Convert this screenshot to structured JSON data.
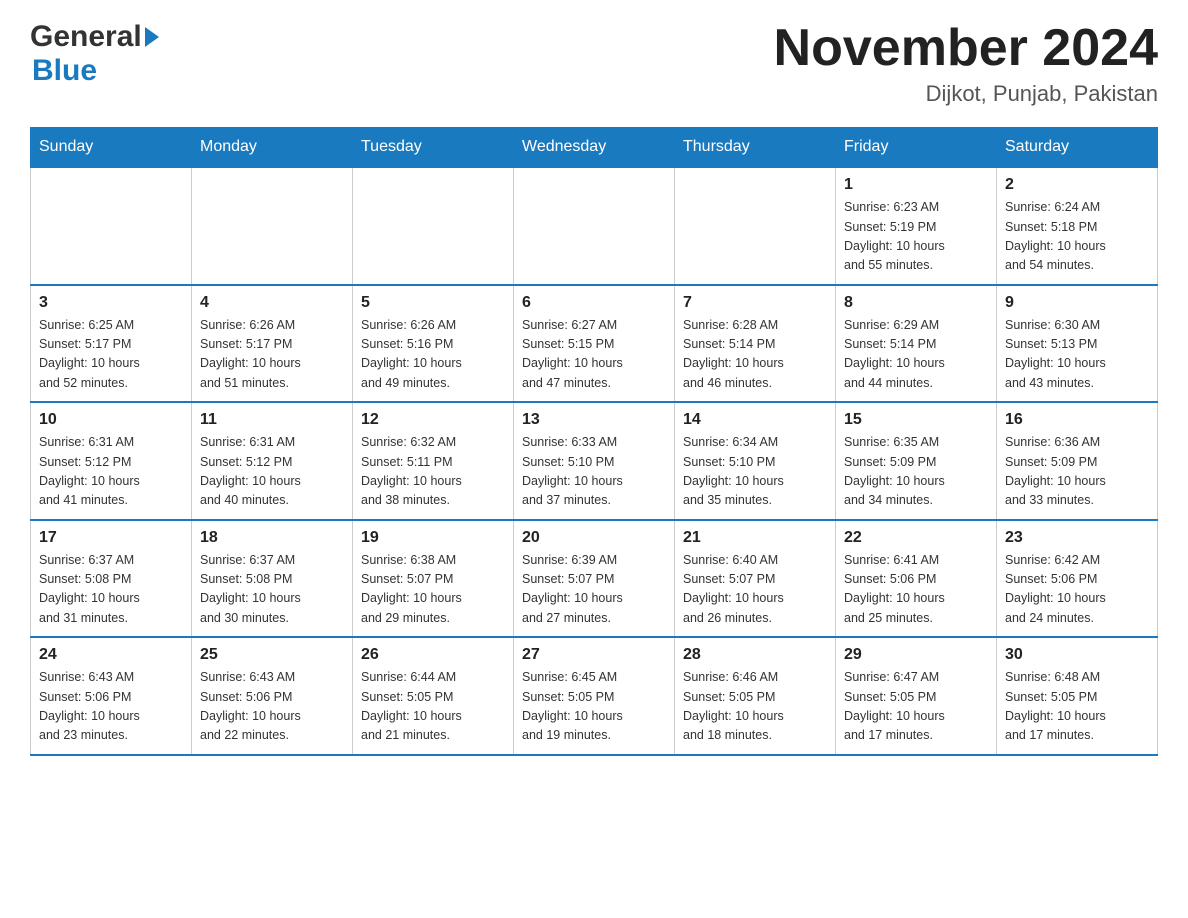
{
  "header": {
    "logo_general": "General",
    "logo_arrow_symbol": "▶",
    "logo_blue": "Blue",
    "month_title": "November 2024",
    "location": "Dijkot, Punjab, Pakistan"
  },
  "weekdays": [
    "Sunday",
    "Monday",
    "Tuesday",
    "Wednesday",
    "Thursday",
    "Friday",
    "Saturday"
  ],
  "weeks": [
    [
      {
        "day": "",
        "info": ""
      },
      {
        "day": "",
        "info": ""
      },
      {
        "day": "",
        "info": ""
      },
      {
        "day": "",
        "info": ""
      },
      {
        "day": "",
        "info": ""
      },
      {
        "day": "1",
        "info": "Sunrise: 6:23 AM\nSunset: 5:19 PM\nDaylight: 10 hours\nand 55 minutes."
      },
      {
        "day": "2",
        "info": "Sunrise: 6:24 AM\nSunset: 5:18 PM\nDaylight: 10 hours\nand 54 minutes."
      }
    ],
    [
      {
        "day": "3",
        "info": "Sunrise: 6:25 AM\nSunset: 5:17 PM\nDaylight: 10 hours\nand 52 minutes."
      },
      {
        "day": "4",
        "info": "Sunrise: 6:26 AM\nSunset: 5:17 PM\nDaylight: 10 hours\nand 51 minutes."
      },
      {
        "day": "5",
        "info": "Sunrise: 6:26 AM\nSunset: 5:16 PM\nDaylight: 10 hours\nand 49 minutes."
      },
      {
        "day": "6",
        "info": "Sunrise: 6:27 AM\nSunset: 5:15 PM\nDaylight: 10 hours\nand 47 minutes."
      },
      {
        "day": "7",
        "info": "Sunrise: 6:28 AM\nSunset: 5:14 PM\nDaylight: 10 hours\nand 46 minutes."
      },
      {
        "day": "8",
        "info": "Sunrise: 6:29 AM\nSunset: 5:14 PM\nDaylight: 10 hours\nand 44 minutes."
      },
      {
        "day": "9",
        "info": "Sunrise: 6:30 AM\nSunset: 5:13 PM\nDaylight: 10 hours\nand 43 minutes."
      }
    ],
    [
      {
        "day": "10",
        "info": "Sunrise: 6:31 AM\nSunset: 5:12 PM\nDaylight: 10 hours\nand 41 minutes."
      },
      {
        "day": "11",
        "info": "Sunrise: 6:31 AM\nSunset: 5:12 PM\nDaylight: 10 hours\nand 40 minutes."
      },
      {
        "day": "12",
        "info": "Sunrise: 6:32 AM\nSunset: 5:11 PM\nDaylight: 10 hours\nand 38 minutes."
      },
      {
        "day": "13",
        "info": "Sunrise: 6:33 AM\nSunset: 5:10 PM\nDaylight: 10 hours\nand 37 minutes."
      },
      {
        "day": "14",
        "info": "Sunrise: 6:34 AM\nSunset: 5:10 PM\nDaylight: 10 hours\nand 35 minutes."
      },
      {
        "day": "15",
        "info": "Sunrise: 6:35 AM\nSunset: 5:09 PM\nDaylight: 10 hours\nand 34 minutes."
      },
      {
        "day": "16",
        "info": "Sunrise: 6:36 AM\nSunset: 5:09 PM\nDaylight: 10 hours\nand 33 minutes."
      }
    ],
    [
      {
        "day": "17",
        "info": "Sunrise: 6:37 AM\nSunset: 5:08 PM\nDaylight: 10 hours\nand 31 minutes."
      },
      {
        "day": "18",
        "info": "Sunrise: 6:37 AM\nSunset: 5:08 PM\nDaylight: 10 hours\nand 30 minutes."
      },
      {
        "day": "19",
        "info": "Sunrise: 6:38 AM\nSunset: 5:07 PM\nDaylight: 10 hours\nand 29 minutes."
      },
      {
        "day": "20",
        "info": "Sunrise: 6:39 AM\nSunset: 5:07 PM\nDaylight: 10 hours\nand 27 minutes."
      },
      {
        "day": "21",
        "info": "Sunrise: 6:40 AM\nSunset: 5:07 PM\nDaylight: 10 hours\nand 26 minutes."
      },
      {
        "day": "22",
        "info": "Sunrise: 6:41 AM\nSunset: 5:06 PM\nDaylight: 10 hours\nand 25 minutes."
      },
      {
        "day": "23",
        "info": "Sunrise: 6:42 AM\nSunset: 5:06 PM\nDaylight: 10 hours\nand 24 minutes."
      }
    ],
    [
      {
        "day": "24",
        "info": "Sunrise: 6:43 AM\nSunset: 5:06 PM\nDaylight: 10 hours\nand 23 minutes."
      },
      {
        "day": "25",
        "info": "Sunrise: 6:43 AM\nSunset: 5:06 PM\nDaylight: 10 hours\nand 22 minutes."
      },
      {
        "day": "26",
        "info": "Sunrise: 6:44 AM\nSunset: 5:05 PM\nDaylight: 10 hours\nand 21 minutes."
      },
      {
        "day": "27",
        "info": "Sunrise: 6:45 AM\nSunset: 5:05 PM\nDaylight: 10 hours\nand 19 minutes."
      },
      {
        "day": "28",
        "info": "Sunrise: 6:46 AM\nSunset: 5:05 PM\nDaylight: 10 hours\nand 18 minutes."
      },
      {
        "day": "29",
        "info": "Sunrise: 6:47 AM\nSunset: 5:05 PM\nDaylight: 10 hours\nand 17 minutes."
      },
      {
        "day": "30",
        "info": "Sunrise: 6:48 AM\nSunset: 5:05 PM\nDaylight: 10 hours\nand 17 minutes."
      }
    ]
  ]
}
